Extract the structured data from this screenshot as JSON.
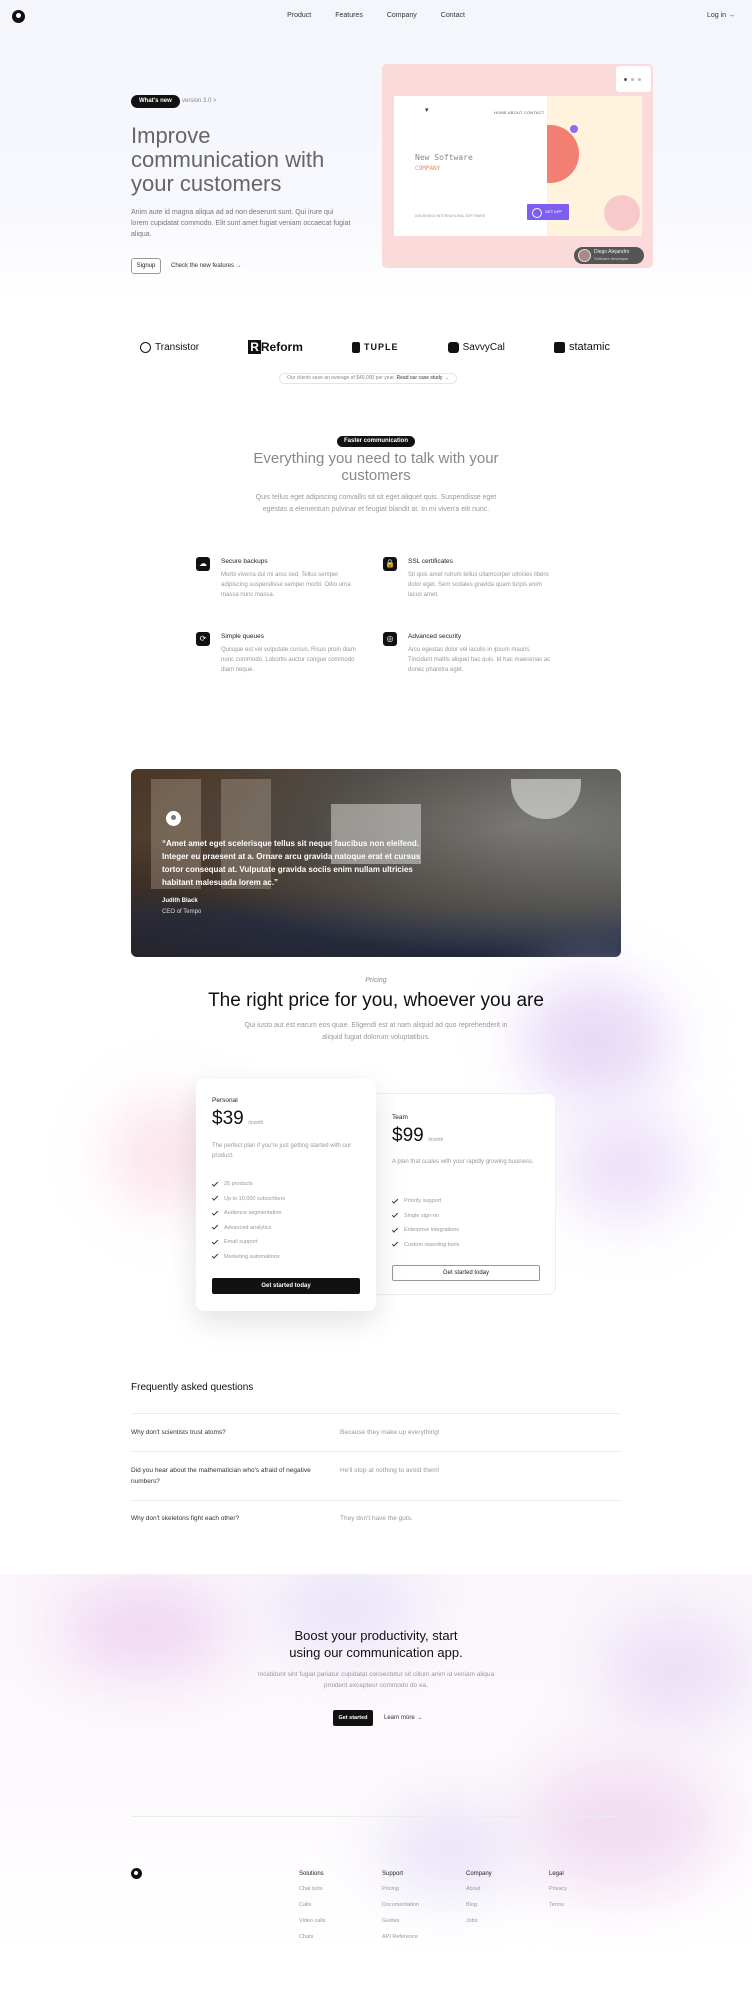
{
  "header": {
    "nav": [
      "Product",
      "Features",
      "Company",
      "Contact"
    ],
    "login": "Log in →"
  },
  "hero": {
    "badge": "What's new",
    "version": "version 3.0  >",
    "title": "Improve communication with your customers",
    "text": "Anim aute id magna aliqua ad ad non deserunt sunt. Qui irure qui lorem cupidatat commodo. Elit sunt amet fugiat veniam occaecat fugiat aliqua.",
    "signup": "Signup",
    "check_new": "Check the new features →",
    "mockup": {
      "title": "New Software",
      "subtitle": "COMPANY",
      "nav": "HOME   ABOUT   CONTACT",
      "small": "A BUSINESS INTERNATIONAL SOFTWARE",
      "button": "GET APP"
    },
    "user": {
      "name": "Diego Alejandro",
      "role": "Software developer"
    }
  },
  "logos": {
    "items": [
      "Transistor",
      "Reform",
      "TUPLE",
      "SavvyCal",
      "statamic"
    ],
    "savings": "Our clients save an average of $40,000 per year.",
    "case_study": "Read our case study →"
  },
  "features": {
    "badge": "Faster communication",
    "title": "Everything you need to talk with your customers",
    "text": "Quis tellus eget adipiscing convallis sit sit eget aliquet quis. Suspendisse eget egestas a elementum pulvinar et feugiat blandit at. In mi viverra elit nunc.",
    "items": [
      {
        "icon": "☁",
        "name": "Secure backups",
        "desc": "Morbi viverra dui mi arcu sed. Tellus semper adipiscing suspendisse semper morbi. Odio urna massa nunc massa."
      },
      {
        "icon": "🔒",
        "name": "SSL certificates",
        "desc": "Sit quis amet rutrum tellus ullamcorper ultricies libero dolor eget. Sem sodales gravida quam turpis enim lacus amet."
      },
      {
        "icon": "⟳",
        "name": "Simple queues",
        "desc": "Quisque est vel vulputate cursus. Risus proin diam nunc commodo. Lobortis auctor congue commodo diam neque."
      },
      {
        "icon": "◎",
        "name": "Advanced security",
        "desc": "Arcu egestas dolor vel iaculis in ipsum mauris. Tincidunt mattis aliquet hac quis. Id hac maecenas ac donec pharetra eget."
      }
    ]
  },
  "testimonial": {
    "quote": "“Amet amet eget scelerisque tellus sit neque faucibus non eleifend. Integer eu praesent at a. Ornare arcu gravida natoque erat et cursus tortor consequat at. Vulputate gravida sociis enim nullam ultricies habitant malesuada lorem ac.”",
    "name": "Judith Black",
    "role": "CEO of Tempo"
  },
  "pricing": {
    "eyebrow": "Pricing",
    "title": "The right price for you, whoever you are",
    "text": "Qui iusto aut est earum eos quae. Eligendi est at nam aliquid ad quo reprehenderit in aliquid fugiat dolorum voluptatibus.",
    "plans": [
      {
        "name": "Personal",
        "price": "$39",
        "per": "/month",
        "desc": "The perfect plan if you're just getting started with our product.",
        "features": [
          "25 products",
          "Up to 10,000 subscribers",
          "Audience segmentation",
          "Advanced analytics",
          "Email support",
          "Marketing automations"
        ],
        "cta": "Get started today"
      },
      {
        "name": "Team",
        "price": "$99",
        "per": "/month",
        "desc": "A plan that scales with your rapidly growing business.",
        "features": [
          "Priority support",
          "Single sign-on",
          "Enterprise integrations",
          "Custom reporting tools"
        ],
        "cta": "Get started today"
      }
    ]
  },
  "faq": {
    "title": "Frequently asked questions",
    "items": [
      {
        "q": "Why don't scientists trust atoms?",
        "a": "Because they make up everything!"
      },
      {
        "q": "Did you hear about the mathematician who's afraid of negative numbers?",
        "a": "He'll stop at nothing to avoid them!"
      },
      {
        "q": "Why don't skeletons fight each other?",
        "a": "They don't have the guts."
      }
    ]
  },
  "cta": {
    "title": "Boost your productivity, start using our communication app.",
    "text": "Incididunt sint fugiat pariatur cupidatat consectetur sit cillum anim id veniam aliqua proident excepteur commodo do ea.",
    "primary": "Get started",
    "secondary": "Learn more →"
  },
  "footer": {
    "columns": [
      {
        "title": "Solutions",
        "links": [
          "Chat bots",
          "Calls",
          "Video calls",
          "Chats"
        ]
      },
      {
        "title": "Support",
        "links": [
          "Pricing",
          "Documentation",
          "Guides",
          "API Reference"
        ]
      },
      {
        "title": "Company",
        "links": [
          "About",
          "Blog",
          "Jobs"
        ]
      },
      {
        "title": "Legal",
        "links": [
          "Privacy",
          "Terms"
        ]
      }
    ]
  },
  "colors": {
    "accent_dark": "#111111",
    "hero_card": "#fadadb",
    "mock_orange": "#f27f72",
    "mock_purple": "#8f6cf0"
  }
}
